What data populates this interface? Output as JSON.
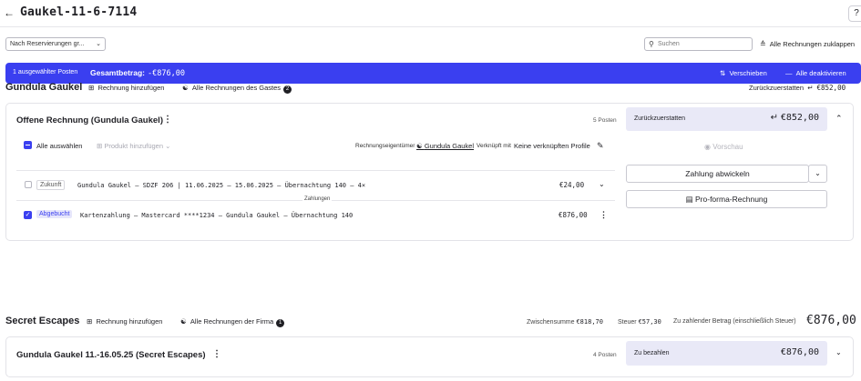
{
  "header": {
    "title": "Gaukel-11-6-7114",
    "back_icon": "arrow-left-icon",
    "help_icon": "help-circle-icon"
  },
  "toolbar": {
    "filter_value": "Nach Reservierungen gr...",
    "search_placeholder": "Suchen",
    "collapse_all_label": "Alle Rechnungen zuklappen"
  },
  "selection_bar": {
    "count_label": "1 ausgewählter Posten",
    "total_label": "Gesamtbetrag:",
    "total_value": "-€876,00",
    "move_label": "Verschieben",
    "deactivate_label": "Alle deaktivieren",
    "bg_color": "#3a3ff0"
  },
  "guest": {
    "name": "Gundula Gaukel",
    "add_invoice_label": "Rechnung hinzufügen",
    "all_invoices_label": "Alle Rechnungen des Gastes",
    "all_invoices_count": "2",
    "refund_label": "Zurückzuerstatten",
    "refund_value": "€852,00"
  },
  "invoice1": {
    "title": "Offene Rechnung (Gundula Gaukel)",
    "count": "5 Posten",
    "summary_label": "Zurückzuerstatten",
    "summary_value": "€852,00",
    "select_all_label": "Alle auswählen",
    "add_product_label": "Produkt hinzufügen",
    "owner_label": "Rechnungseigentümer",
    "owner_name": "Gundula Gaukel",
    "linked_label": "Verknüpft mit",
    "linked_value": "Keine verknüpften Profile",
    "preview_label": "Vorschau",
    "pay_label": "Zahlung abwickeln",
    "proforma_label": "Pro-forma-Rechnung",
    "payments_header": "Zahlungen",
    "items": [
      {
        "tag": "Zukunft",
        "description": "Gundula Gaukel — SDZF 206 | 11.06.2025 — 15.06.2025 — Übernachtung 140 — 4×",
        "amount": "€24,00"
      },
      {
        "tag": "Abgebucht",
        "description": "Kartenzahlung — Mastercard ****1234 — Gundula Gaukel — Übernachtung 140",
        "amount": "€876,00"
      }
    ]
  },
  "company": {
    "name": "Secret Escapes",
    "add_invoice_label": "Rechnung hinzufügen",
    "all_invoices_label": "Alle Rechnungen der Firma",
    "all_invoices_count": "1",
    "subtotal_label": "Zwischensumme",
    "subtotal_value": "€818,70",
    "tax_label": "Steuer",
    "tax_value": "€57,30",
    "due_label": "Zu zahlender Betrag (einschließlich Steuer)",
    "due_value": "€876,00"
  },
  "invoice2": {
    "title": "Gundula Gaukel 11.-16.05.25 (Secret Escapes)",
    "count": "4 Posten",
    "summary_label": "Zu bezahlen",
    "summary_value": "€876,00"
  }
}
